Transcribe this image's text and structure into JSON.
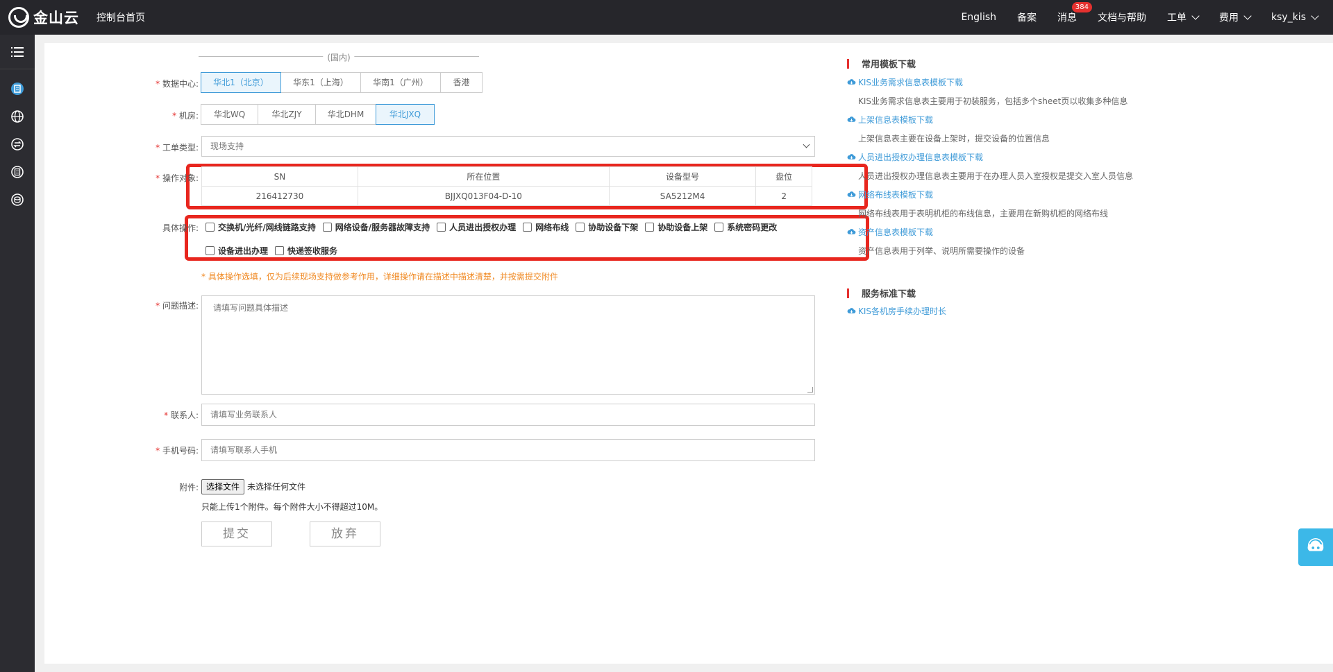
{
  "header": {
    "logo_text": "金山云",
    "console_home": "控制台首页",
    "nav": {
      "english": "English",
      "beian": "备案",
      "messages": "消息",
      "messages_badge": "384",
      "docs": "文档与帮助",
      "tickets": "工单",
      "billing": "费用",
      "user": "ksy_kis"
    }
  },
  "form": {
    "datacenter": {
      "label": "数据中心:",
      "group_title": "(国内)",
      "options": [
        "华北1（北京）",
        "华东1（上海）",
        "华南1（广州）",
        "香港"
      ],
      "selected": "华北1（北京）"
    },
    "room": {
      "label": "机房:",
      "options": [
        "华北WQ",
        "华北ZJY",
        "华北DHM",
        "华北JXQ"
      ],
      "selected": "华北JXQ"
    },
    "ticket_type": {
      "label": "工单类型:",
      "value": "现场支持"
    },
    "target": {
      "label": "操作对象:",
      "columns": [
        "SN",
        "所在位置",
        "设备型号",
        "盘位"
      ],
      "rows": [
        [
          "216412730",
          "BJJXQ013F04-D-10",
          "SA5212M4",
          "2"
        ]
      ]
    },
    "operations": {
      "label": "具体操作:",
      "options": [
        "交换机/光纤/网线链路支持",
        "网络设备/服务器故障支持",
        "人员进出授权办理",
        "网络布线",
        "协助设备下架",
        "协助设备上架",
        "系统密码更改",
        "设备进出办理",
        "快递签收服务"
      ],
      "hint": "* 具体操作选填，仅为后续现场支持做参考作用，详细操作请在描述中描述清楚，并按需提交附件"
    },
    "description": {
      "label": "问题描述:",
      "placeholder": "请填写问题具体描述"
    },
    "contact": {
      "label": "联系人:",
      "placeholder": "请填写业务联系人"
    },
    "phone": {
      "label": "手机号码:",
      "placeholder": "请填写联系人手机"
    },
    "attachment": {
      "label": "附件:",
      "button": "选择文件",
      "status": "未选择任何文件",
      "note": "只能上传1个附件。每个附件大小不得超过10M。"
    },
    "submit_label": "提交",
    "discard_label": "放弃"
  },
  "right_panel": {
    "templates_title": "常用模板下载",
    "templates": [
      {
        "link": "KIS业务需求信息表模板下载",
        "desc": "KIS业务需求信息表主要用于初装服务，包括多个sheet页以收集多种信息"
      },
      {
        "link": "上架信息表模板下载",
        "desc": "上架信息表主要在设备上架时，提交设备的位置信息"
      },
      {
        "link": "人员进出授权办理信息表模板下载",
        "desc": "人员进出授权办理信息表主要用于在办理人员入室授权是提交入室人员信息"
      },
      {
        "link": "网络布线表模板下载",
        "desc": "网络布线表用于表明机柜的布线信息，主要用在新购机柜的网络布线"
      },
      {
        "link": "资产信息表模板下载",
        "desc": "资产信息表用于列举、说明所需要操作的设备"
      }
    ],
    "standards_title": "服务标准下载",
    "standards": [
      {
        "link": "KIS各机房手续办理时长"
      }
    ]
  },
  "colors": {
    "accent": "#3f9bd8",
    "highlight_border": "#e8261e",
    "hint": "#f08a24",
    "topbar": "#26262b"
  },
  "icons": {
    "sidebar": [
      "list-icon",
      "document-icon",
      "globe-icon",
      "exchange-icon",
      "report-icon",
      "cloud-db-icon"
    ],
    "download": "cloud-download-icon",
    "float": "customer-service-icon"
  }
}
